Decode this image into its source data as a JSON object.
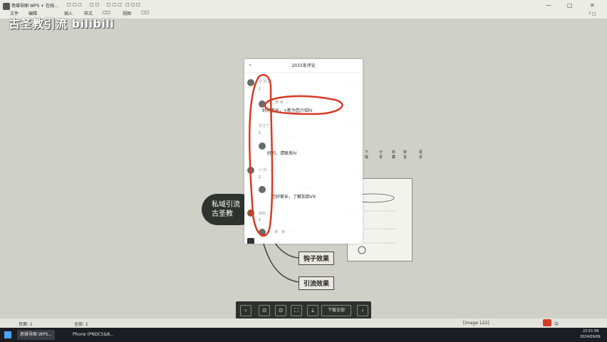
{
  "titlebar": {
    "title": "思维导图 WPS + 在线…",
    "tabs": [
      "□ □ □",
      "□ □",
      "□ □ □",
      "□ □ □"
    ],
    "menu": [
      "文件",
      "编辑",
      "插入",
      "样式",
      "□□",
      "视图",
      "□□"
    ],
    "controls": [
      "—",
      "□",
      "✕"
    ]
  },
  "watermark": "古圣教引流 bilibili",
  "phone": {
    "title": "2033条评论",
    "comments": [
      {
        "name": "刘 好 娃 · · · · ·",
        "count": "1",
        "reply_name": "· 幸 幸 · · · ·",
        "reply_text": "好的家长，+新为您介绍hi",
        "reply_dots": "· ·"
      },
      {
        "name": "关注了 · · · · · ·",
        "count": "1",
        "reply_name": "· · ·",
        "reply_text": "好的，请联系hi",
        "reply_dots": "· ·"
      },
      {
        "name": "小 红 · · · · ·",
        "count": "1",
        "reply_name": "· · · · ·",
        "reply_text": "您好家长，了解加我VX",
        "reply_dots": "· ·"
      },
      {
        "name": "西安 · · · · · ·",
        "count": "1",
        "reply_name": "· · 家 · 幸 · · · ·",
        "reply_text": "",
        "reply_dots": "· ·"
      }
    ]
  },
  "mindmap": {
    "root": "私域引流\n古圣教",
    "branches": [
      "钩子效果",
      "引流效果"
    ]
  },
  "side_panel": {
    "buttons": [
      "下载",
      "分享",
      "收藏",
      "转发",
      "更多"
    ]
  },
  "toolbar": {
    "buttons": [
      "‹",
      "⊙",
      "⊙",
      "⛶",
      "⤓",
      "下载全部",
      "›"
    ]
  },
  "statusbar": {
    "left": "页面: 1",
    "middle": "全部: 1",
    "image_label": "[image 122]"
  },
  "taskbar": {
    "items": [
      "思维导图 WPS...",
      "Phone (PNDC5&8..."
    ],
    "time": "22:51:58",
    "date": "2024/09/09",
    "ime": "中"
  },
  "colors": {
    "accent_red": "#d63b24",
    "toolbar_dark": "#2e322e",
    "taskbar": "#1b1d22",
    "canvas": "#cfd0c8"
  }
}
